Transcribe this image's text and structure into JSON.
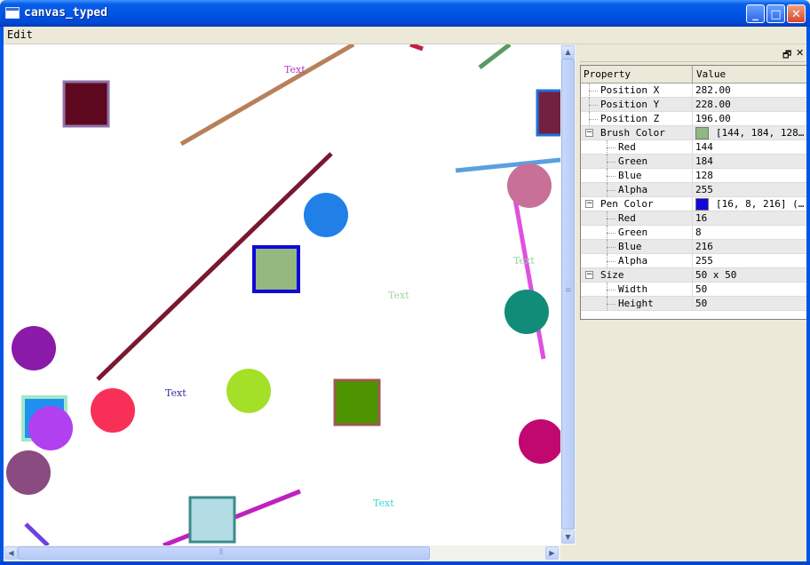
{
  "window": {
    "title": "canvas_typed"
  },
  "titlebar_buttons": {
    "minimize": "_",
    "maximize": "□",
    "close": "✕"
  },
  "menu": {
    "edit": "Edit"
  },
  "canvas": {
    "labels": [
      {
        "text": "Text",
        "color": "#b43cc0"
      },
      {
        "text": "Text",
        "color": "#9bd09b"
      },
      {
        "text": "Text",
        "color": "#a8d4a8"
      },
      {
        "text": "Text",
        "color": "#3030a0"
      },
      {
        "text": "Text",
        "color": "#40d8d0"
      }
    ],
    "colors": {
      "line_brown": "#b8805a",
      "line_maroon": "#7a1830",
      "line_blue": "#5aa0e0",
      "line_magenta": "#e050e0",
      "line_green": "#5a9a60",
      "line_red": "#c02040",
      "line_purple": "#c020c0",
      "line_violet": "#7040e0",
      "rect_maroon_fill": "#5e0820",
      "rect_maroon_pen": "#9070a8",
      "rect_green_fill": "#94b880",
      "rect_green_pen": "#1008d8",
      "rect_olive_fill": "#4e9400",
      "rect_olive_pen": "#9c5a50",
      "rect_cyan_fill": "#b4dce4",
      "rect_cyan_pen": "#3a8c8c",
      "rect_wine_fill": "#722040",
      "rect_wine_pen": "#2070d8",
      "rect_sky_fill": "#2090f0",
      "rect_sky_pen": "#a0e8c8",
      "circ_blue": "#2080e8",
      "circ_pink": "#c87098",
      "circ_teal": "#108c78",
      "circ_purple": "#8a1aa8",
      "circ_red": "#f83058",
      "circ_lime": "#a4e028",
      "circ_violet": "#b040f0",
      "circ_plum": "#8a4c80",
      "circ_crimson": "#c00870"
    }
  },
  "panel": {
    "header_buttons": {
      "float": "🗗",
      "close": "✕"
    },
    "columns": {
      "property": "Property",
      "value": "Value"
    },
    "rows": [
      {
        "name": "Position X",
        "value": "282.00",
        "level": 0,
        "expander": ""
      },
      {
        "name": "Position Y",
        "value": "228.00",
        "level": 0,
        "expander": ""
      },
      {
        "name": "Position Z",
        "value": "196.00",
        "level": 0,
        "expander": ""
      },
      {
        "name": "Brush Color",
        "value": "[144, 184, 128…",
        "level": 0,
        "expander": "−",
        "swatch": "#90b880"
      },
      {
        "name": "Red",
        "value": "144",
        "level": 1,
        "expander": ""
      },
      {
        "name": "Green",
        "value": "184",
        "level": 1,
        "expander": ""
      },
      {
        "name": "Blue",
        "value": "128",
        "level": 1,
        "expander": ""
      },
      {
        "name": "Alpha",
        "value": "255",
        "level": 1,
        "expander": ""
      },
      {
        "name": "Pen Color",
        "value": "[16, 8, 216] (…",
        "level": 0,
        "expander": "−",
        "swatch": "#1008d8"
      },
      {
        "name": "Red",
        "value": "16",
        "level": 1,
        "expander": ""
      },
      {
        "name": "Green",
        "value": "8",
        "level": 1,
        "expander": ""
      },
      {
        "name": "Blue",
        "value": "216",
        "level": 1,
        "expander": ""
      },
      {
        "name": "Alpha",
        "value": "255",
        "level": 1,
        "expander": ""
      },
      {
        "name": "Size",
        "value": "50 x 50",
        "level": 0,
        "expander": "−"
      },
      {
        "name": "Width",
        "value": "50",
        "level": 1,
        "expander": ""
      },
      {
        "name": "Height",
        "value": "50",
        "level": 1,
        "expander": ""
      }
    ]
  }
}
